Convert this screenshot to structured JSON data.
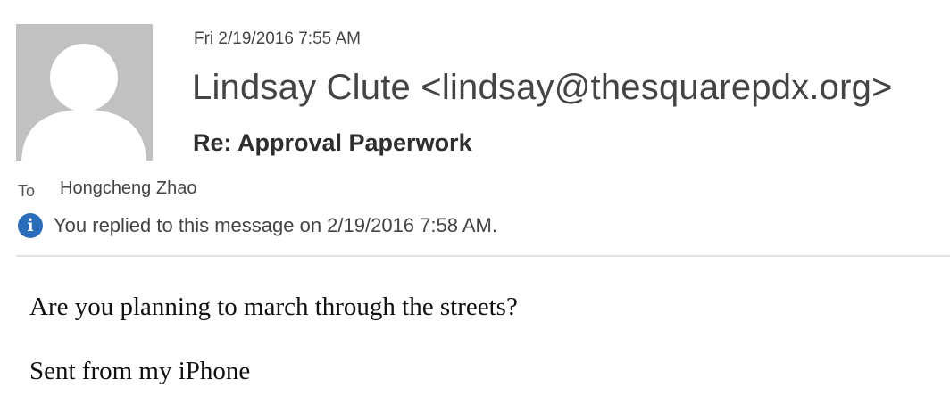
{
  "message": {
    "date": "Fri 2/19/2016 7:55 AM",
    "sender": "Lindsay Clute <lindsay@thesquarepdx.org>",
    "subject": "Re: Approval Paperwork",
    "to_label": "To",
    "to_value": "Hongcheng Zhao",
    "reply_notice": "You replied to this message on 2/19/2016 7:58 AM.",
    "info_icon_glyph": "i",
    "body_lines": [
      "Are you planning to march through the streets?",
      "Sent from my iPhone"
    ]
  },
  "icons": {
    "avatar": "default-person-avatar",
    "info": "info-icon"
  },
  "colors": {
    "avatar_background": "#c1c1c1",
    "avatar_silhouette": "#ffffff",
    "info_icon": "#2a6ebb",
    "divider": "#e3e3e3"
  }
}
